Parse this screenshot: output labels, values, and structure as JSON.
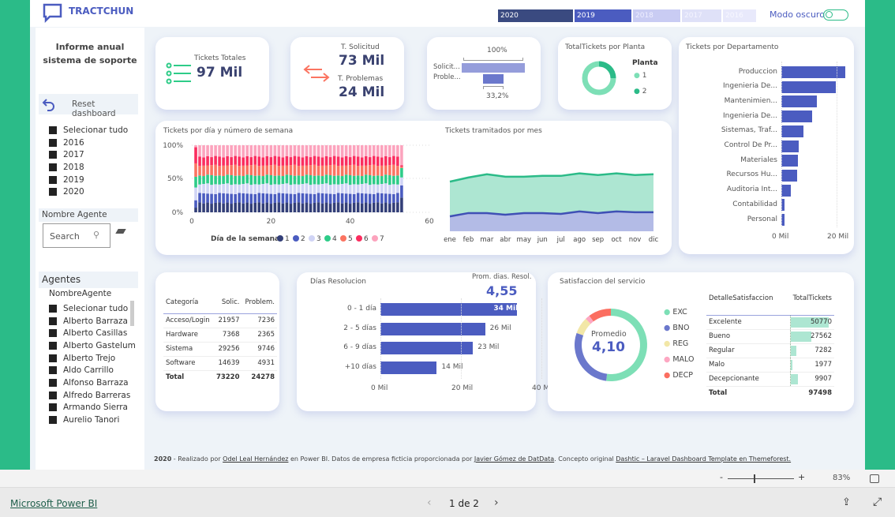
{
  "brand": {
    "name": "TRACTCHUN"
  },
  "year_tabs": [
    {
      "label": "2020",
      "bg": "#3a4a80",
      "fg": "#fff"
    },
    {
      "label": "2019",
      "bg": "#4b5cc0",
      "fg": "#fff"
    },
    {
      "label": "2018",
      "bg": "#c9ccf3",
      "fg": "#eef"
    },
    {
      "label": "2017",
      "bg": "#dfe1f8",
      "fg": "#f4f4ff"
    },
    {
      "label": "2016",
      "bg": "#e8e9fb",
      "fg": "#f7f7ff"
    }
  ],
  "dark_mode": {
    "label": "Modo oscuro",
    "on": false
  },
  "sidebar": {
    "title": "Informe anual sistema de soporte",
    "reset_label": "Reset dashboard",
    "years": [
      "Selecionar tudo",
      "2016",
      "2017",
      "2018",
      "2019",
      "2020"
    ],
    "agent_search": {
      "header": "Nombre Agente",
      "placeholder": "Search"
    },
    "agents": {
      "header": "Agentes",
      "field": "NombreAgente",
      "items": [
        "Selecionar tudo",
        "Alberto Barraza",
        "Alberto Casillas",
        "Alberto Gastelum",
        "Alberto Trejo",
        "Aldo Carrillo",
        "Alfonso Barraza",
        "Alfredo Barreras",
        "Armando Sierra",
        "Aurelio Tanori"
      ]
    }
  },
  "kpi_total": {
    "label": "Tickets Totales",
    "value": "97 Mil"
  },
  "kpi_split": {
    "sol_label": "T. Solicitud",
    "sol_value": "73 Mil",
    "prob_label": "T. Problemas",
    "prob_value": "24 Mil"
  },
  "funnel": {
    "top_pct": "100%",
    "bottom_pct": "33,2%",
    "labels": [
      "Solicit...",
      "Proble..."
    ],
    "values": [
      100,
      33.2
    ]
  },
  "planta": {
    "title": "TotalTickets por Planta",
    "legend_title": "Planta",
    "items": [
      {
        "label": "1",
        "color": "#7ddfb6",
        "share": 75
      },
      {
        "label": "2",
        "color": "#2bbb88",
        "share": 25
      }
    ]
  },
  "chart_data": [
    {
      "type": "bar",
      "orientation": "horizontal",
      "title": "Tickets por Departamento",
      "categories": [
        "Produccion",
        "Ingenieria De...",
        "Mantenimien...",
        "Ingenieria De...",
        "Sistemas, Traf...",
        "Control De Pr...",
        "Materiales",
        "Recursos Hu...",
        "Auditoria Int...",
        "Contabilidad",
        "Personal"
      ],
      "values": [
        23000,
        19700,
        12900,
        11100,
        8000,
        6300,
        6000,
        5700,
        3400,
        1100,
        1000
      ],
      "xticks": [
        "0 Mil",
        "20 Mil"
      ],
      "xlim": [
        0,
        30000
      ],
      "color": "#4b5cc0"
    },
    {
      "type": "bar",
      "stacked": "percent",
      "title": "Tickets por día y número de semana",
      "yticks": [
        "0%",
        "50%",
        "100%"
      ],
      "xticks": [
        "0",
        "20",
        "40",
        "60"
      ],
      "xlim": [
        0,
        60
      ],
      "legend_title": "Día de la semana",
      "series_names": [
        "1",
        "2",
        "3",
        "4",
        "5",
        "6",
        "7"
      ],
      "colors": [
        "#333f78",
        "#4b5cc0",
        "#d0d4f5",
        "#2ecc88",
        "#fb7461",
        "#fb2d5f",
        "#fca3bd"
      ],
      "weeks": 53,
      "typical_shares": [
        14,
        14,
        14,
        13,
        15,
        13,
        17
      ],
      "first_week": [
        7,
        11,
        19,
        16,
        20,
        24,
        3
      ],
      "last_week": [
        22,
        18,
        12,
        14,
        2,
        2,
        30
      ]
    },
    {
      "type": "area",
      "stacked": true,
      "title": "Tickets tramitados por mes",
      "categories": [
        "ene",
        "feb",
        "mar",
        "abr",
        "may",
        "jun",
        "jul",
        "ago",
        "sep",
        "oct",
        "nov",
        "dic"
      ],
      "series": [
        {
          "color": "#3f50b5",
          "fill": "#b3bbe6",
          "values": [
            1800,
            2200,
            2200,
            2000,
            2200,
            2200,
            2100,
            2400,
            2200,
            2400,
            2300,
            2300
          ]
        },
        {
          "color": "#2bbb88",
          "fill": "#ade6d2",
          "values": [
            6000,
            6500,
            6900,
            6600,
            6600,
            6700,
            6700,
            7000,
            6800,
            7000,
            6800,
            6900
          ]
        }
      ],
      "ylim": [
        0,
        10500
      ]
    },
    {
      "type": "bar",
      "orientation": "horizontal",
      "title": "Días Resolucion",
      "categories": [
        "0 - 1 día",
        "2 - 5 días",
        "6 - 9 días",
        "+10 días"
      ],
      "values": [
        34000,
        26000,
        23000,
        14000
      ],
      "data_labels": [
        "34 Mil",
        "26 Mil",
        "23 Mil",
        "14 Mil"
      ],
      "xticks": [
        "0 Mil",
        "20 Mil",
        "40 Mil"
      ],
      "xlim": [
        0,
        40000
      ],
      "color": "#4b5cc0"
    },
    {
      "type": "pie",
      "donut": true,
      "title": "Satisfaccion del servicio",
      "categories": [
        "EXC",
        "BNO",
        "REG",
        "MALO",
        "DECP"
      ],
      "values": [
        50770,
        27562,
        7282,
        1977,
        9907
      ],
      "colors": [
        "#7ddfb6",
        "#6b78cc",
        "#f2e7a7",
        "#fda7c2",
        "#fb6e60"
      ]
    }
  ],
  "categoria_table": {
    "headers": [
      "Categoría",
      "Solic.",
      "Problem."
    ],
    "rows": [
      [
        "Acceso/Login",
        "21957",
        "7236"
      ],
      [
        "Hardware",
        "7368",
        "2365"
      ],
      [
        "Sistema",
        "29256",
        "9746"
      ],
      [
        "Software",
        "14639",
        "4931"
      ]
    ],
    "total": [
      "Total",
      "73220",
      "24278"
    ]
  },
  "resolucion_kpi": {
    "label": "Prom. dias. Resol.",
    "value": "4,55"
  },
  "satisf": {
    "center_label": "Promedio",
    "center_value": "4,10",
    "headers": [
      "DetalleSatisfaccion",
      "TotalTickets"
    ],
    "rows": [
      [
        "Excelente",
        "50770"
      ],
      [
        "Bueno",
        "27562"
      ],
      [
        "Regular",
        "7282"
      ],
      [
        "Malo",
        "1977"
      ],
      [
        "Decepcionante",
        "9907"
      ]
    ],
    "total": [
      "Total",
      "97498"
    ]
  },
  "credits": {
    "year": "2020",
    "t1": " - Realizado por ",
    "l1": "Odel Leal Hernández",
    "t2": " en Power BI. Datos de empresa ficticia proporcionada por ",
    "l2": "Javier Gómez de DatData",
    "t3": ". Concepto original ",
    "l3": "Dashtic – Laravel Dashboard Template en Themeforest."
  },
  "zoom": {
    "minus": "-",
    "plus": "+",
    "value": "83%",
    "level": 83
  },
  "footer": {
    "link": "Microsoft Power BI",
    "page": "1 de 2"
  }
}
